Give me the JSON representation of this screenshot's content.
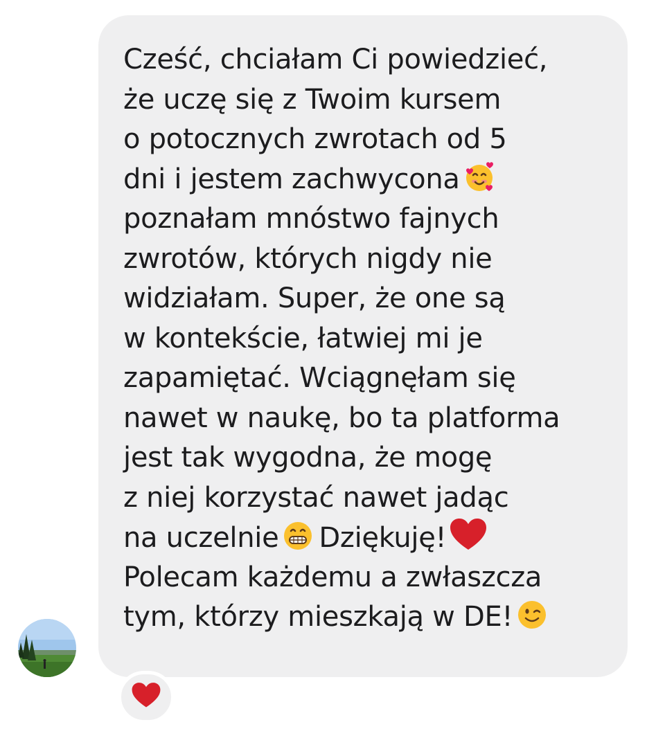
{
  "message": {
    "lines": [
      "Cześć, chciałam Ci powiedzieć,",
      "że uczę się z Twoim kursem",
      "o potocznych zwrotach od 5",
      "dni i jestem zachwycona",
      "poznałam mnóstwo fajnych",
      "zwrotów, których nigdy nie",
      "widziałam. Super, że one są",
      "w kontekście, łatwiej mi je",
      "zapamiętać. Wciągnęłam się",
      "nawet w naukę, bo ta platforma",
      "jest tak wygodna, że mogę",
      "z niej korzystać nawet jadąc",
      "na uczelnie",
      "Dziękuję!",
      "Polecam każdemu a zwłaszcza",
      "tym, którzy mieszkają w DE!"
    ],
    "emojis": {
      "line4": "smiling-face-with-hearts-icon",
      "line13_a": "grinning-face-icon",
      "line13_b": "red-heart-icon",
      "line16": "winking-face-icon"
    }
  },
  "reaction": {
    "emoji": "red-heart-icon"
  },
  "colors": {
    "bubble_bg": "#efeff0",
    "text": "#1c1c1e",
    "heart": "#d7202a",
    "emoji_yellow": "#fbc02d"
  }
}
